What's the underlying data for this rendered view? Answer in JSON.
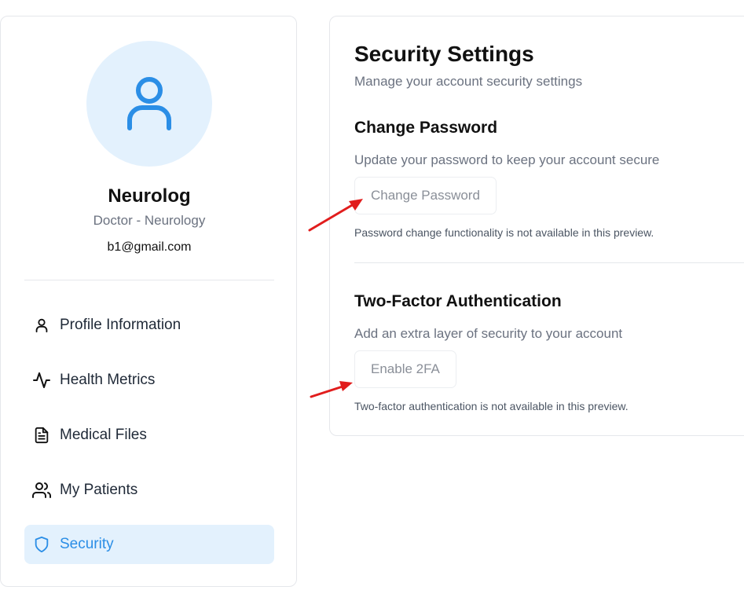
{
  "profile": {
    "name": "Neurolog",
    "role": "Doctor - Neurology",
    "email": "b1@gmail.com",
    "avatar_icon": "user-icon"
  },
  "sidebar": {
    "items": [
      {
        "label": "Profile Information",
        "icon": "user-icon",
        "active": false
      },
      {
        "label": "Health Metrics",
        "icon": "activity-icon",
        "active": false
      },
      {
        "label": "Medical Files",
        "icon": "file-text-icon",
        "active": false
      },
      {
        "label": "My Patients",
        "icon": "users-icon",
        "active": false
      },
      {
        "label": "Security",
        "icon": "shield-icon",
        "active": true
      }
    ]
  },
  "security": {
    "title": "Security Settings",
    "subtitle": "Manage your account security settings",
    "change_password": {
      "title": "Change Password",
      "description": "Update your password to keep your account secure",
      "button_label": "Change Password",
      "note": "Password change functionality is not available in this preview."
    },
    "two_factor": {
      "title": "Two-Factor Authentication",
      "description": "Add an extra layer of security to your account",
      "button_label": "Enable 2FA",
      "note": "Two-factor authentication is not available in this preview."
    }
  },
  "colors": {
    "accent": "#2b8ee6",
    "active_bg": "#e3f1fd",
    "annotation_arrow": "#e11d1d"
  }
}
